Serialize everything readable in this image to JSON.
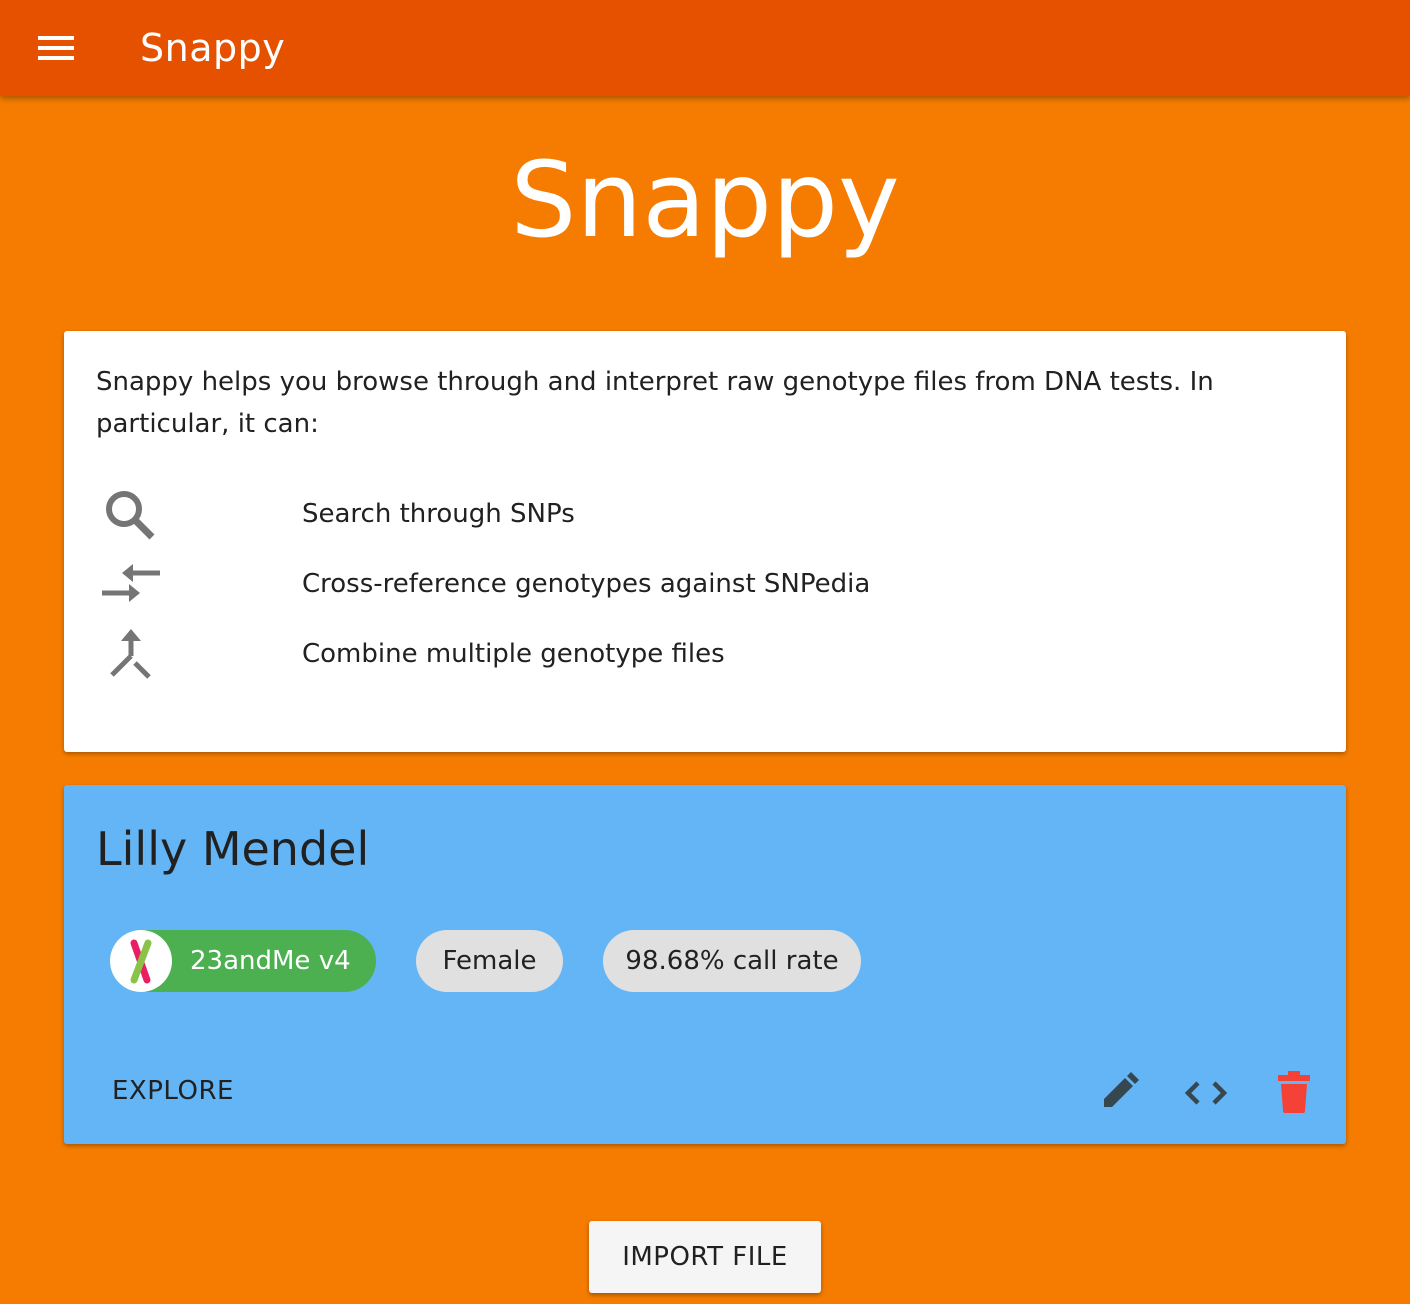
{
  "appbar": {
    "title": "Snappy",
    "color": "#e65100"
  },
  "hero": {
    "title": "Snappy"
  },
  "intro": {
    "text": "Snappy helps you browse through and interpret raw genotype files from DNA tests. In particular, it can:",
    "features": [
      {
        "icon": "search-icon",
        "label": "Search through SNPs"
      },
      {
        "icon": "compare-arrows-icon",
        "label": "Cross-reference genotypes against SNPedia"
      },
      {
        "icon": "merge-icon",
        "label": "Combine multiple genotype files"
      }
    ]
  },
  "genome": {
    "name": "Lilly Mendel",
    "source": "23andMe v4",
    "sex": "Female",
    "call_rate": "98.68% call rate",
    "explore_label": "EXPLORE",
    "actions": [
      {
        "icon": "edit-icon",
        "color": "#37474f"
      },
      {
        "icon": "code-icon",
        "color": "#37474f"
      },
      {
        "icon": "delete-icon",
        "color": "#f44336"
      }
    ],
    "card_color": "#64b5f6",
    "source_chip_color": "#4caf50"
  },
  "import_label": "IMPORT FILE",
  "background_color": "#f57c00"
}
